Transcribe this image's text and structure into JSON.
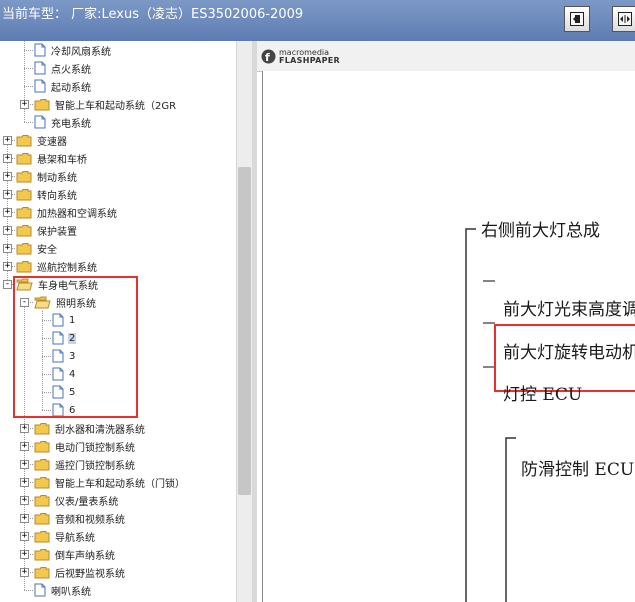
{
  "window": {
    "title": "当前车型：  厂家:Lexus（凌志）ES3502006-2009",
    "buttons": [
      {
        "name": "left-panel-icon"
      },
      {
        "name": "split-panel-icon"
      }
    ]
  },
  "tree": {
    "items": [
      {
        "label": "冷却风扇系统",
        "type": "doc",
        "level": 2
      },
      {
        "label": "点火系统",
        "type": "doc",
        "level": 2
      },
      {
        "label": "起动系统",
        "type": "doc",
        "level": 2
      },
      {
        "label": "智能上车和起动系统（2GR",
        "type": "folder",
        "level": 1,
        "expander": "+"
      },
      {
        "label": "充电系统",
        "type": "doc",
        "level": 2
      },
      {
        "label": "变速器",
        "type": "folder",
        "level": 0,
        "expander": "+"
      },
      {
        "label": "悬架和车桥",
        "type": "folder",
        "level": 0,
        "expander": "+"
      },
      {
        "label": "制动系统",
        "type": "folder",
        "level": 0,
        "expander": "+"
      },
      {
        "label": "转向系统",
        "type": "folder",
        "level": 0,
        "expander": "+"
      },
      {
        "label": "加热器和空调系统",
        "type": "folder",
        "level": 0,
        "expander": "+"
      },
      {
        "label": "保护装置",
        "type": "folder",
        "level": 0,
        "expander": "+"
      },
      {
        "label": "安全",
        "type": "folder",
        "level": 0,
        "expander": "+"
      },
      {
        "label": "巡航控制系统",
        "type": "folder",
        "level": 0,
        "expander": "+"
      },
      {
        "label": "车身电气系统",
        "type": "folder-open",
        "level": 0,
        "expander": "-"
      },
      {
        "label": "照明系统",
        "type": "folder-open",
        "level": 1,
        "expander": "-"
      },
      {
        "label": "1",
        "type": "doc",
        "level": 3
      },
      {
        "label": "2",
        "type": "doc",
        "level": 3,
        "selected": true
      },
      {
        "label": "3",
        "type": "doc",
        "level": 3
      },
      {
        "label": "4",
        "type": "doc",
        "level": 3
      },
      {
        "label": "5",
        "type": "doc",
        "level": 3
      },
      {
        "label": "6",
        "type": "doc",
        "level": 3
      },
      {
        "label": "刮水器和清洗器系统",
        "type": "folder",
        "level": 1,
        "expander": "+"
      },
      {
        "label": "电动门锁控制系统",
        "type": "folder",
        "level": 1,
        "expander": "+"
      },
      {
        "label": "遥控门锁控制系统",
        "type": "folder",
        "level": 1,
        "expander": "+"
      },
      {
        "label": "智能上车和起动系统（门锁）",
        "type": "folder",
        "level": 1,
        "expander": "+"
      },
      {
        "label": "仪表/量表系统",
        "type": "folder",
        "level": 1,
        "expander": "+"
      },
      {
        "label": "音频和视频系统",
        "type": "folder",
        "level": 1,
        "expander": "+"
      },
      {
        "label": "导航系统",
        "type": "folder",
        "level": 1,
        "expander": "+"
      },
      {
        "label": "倒车声纳系统",
        "type": "folder",
        "level": 1,
        "expander": "+"
      },
      {
        "label": "后视野监视系统",
        "type": "folder",
        "level": 1,
        "expander": "+"
      },
      {
        "label": "喇叭系统",
        "type": "doc",
        "level": 2
      }
    ]
  },
  "viewer": {
    "logo_line1": "macromedia",
    "logo_line2": "FLASHPAPER",
    "lines": [
      {
        "text": "右侧前大灯总成",
        "name": "doc-heading-right-headlamp"
      },
      {
        "text": "前大灯光束高度调",
        "name": "doc-item-beam-level"
      },
      {
        "text": "前大灯旋转电动机",
        "name": "doc-item-swivel-motor"
      },
      {
        "text": "灯控  ECU",
        "name": "doc-item-light-control-ecu"
      },
      {
        "text": "防滑控制  ECU",
        "name": "doc-item-skid-control-ecu"
      }
    ]
  },
  "colors": {
    "titlebar": "#6a88ba",
    "highlight": "#e8302e",
    "selection": "#c6d4ee",
    "folder": "#f2c94c"
  }
}
